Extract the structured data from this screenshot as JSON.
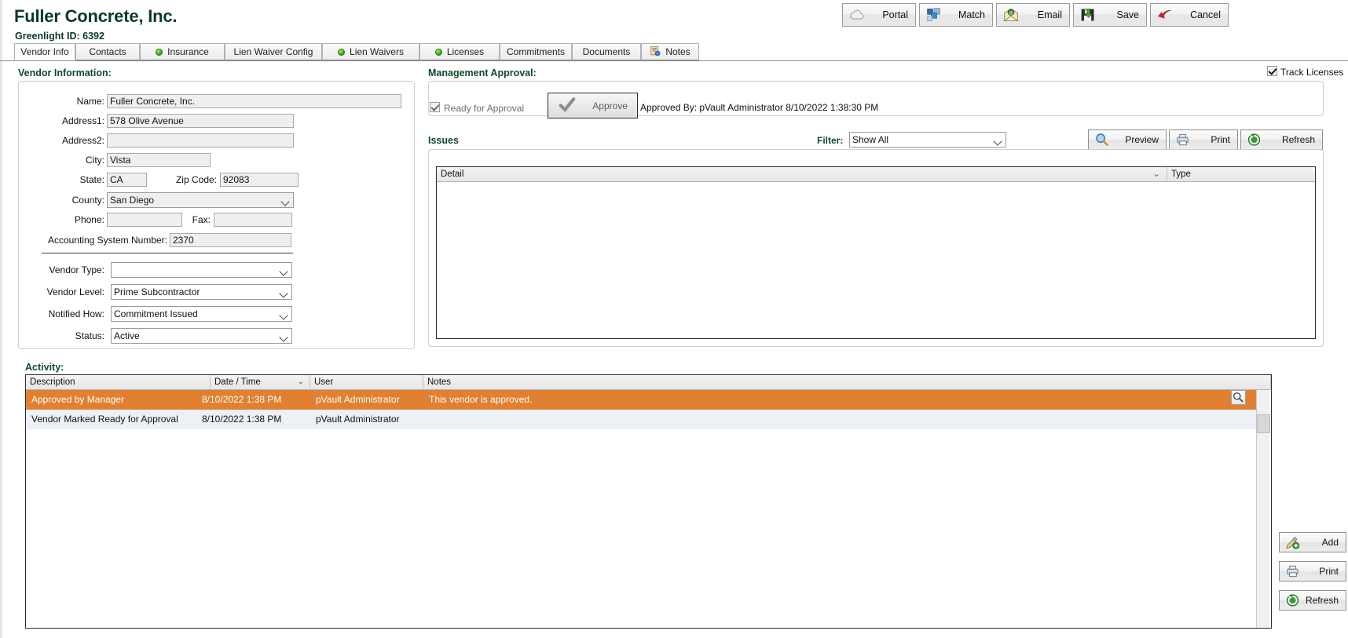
{
  "header": {
    "title": "Fuller Concrete, Inc.",
    "subtitle": "Greenlight ID: 6392",
    "toolbar": [
      {
        "label": "Portal",
        "icon": "cloud-icon"
      },
      {
        "label": "Match",
        "icon": "match-squares-icon"
      },
      {
        "label": "Email",
        "icon": "envelope-icon"
      },
      {
        "label": "Save",
        "icon": "floppy-disk-icon"
      },
      {
        "label": "Cancel",
        "icon": "red-arrow-icon"
      }
    ]
  },
  "tabs": [
    {
      "label": "Vendor Info",
      "active": true,
      "status_dot": false,
      "icon": ""
    },
    {
      "label": "Contacts",
      "active": false,
      "status_dot": false,
      "icon": ""
    },
    {
      "label": "Insurance",
      "active": false,
      "status_dot": true,
      "icon": ""
    },
    {
      "label": "Lien Waiver Config",
      "active": false,
      "status_dot": false,
      "icon": ""
    },
    {
      "label": "Lien Waivers",
      "active": false,
      "status_dot": true,
      "icon": ""
    },
    {
      "label": "Licenses",
      "active": false,
      "status_dot": true,
      "icon": ""
    },
    {
      "label": "Commitments",
      "active": false,
      "status_dot": false,
      "icon": ""
    },
    {
      "label": "Documents",
      "active": false,
      "status_dot": false,
      "icon": ""
    },
    {
      "label": "Notes",
      "active": false,
      "status_dot": false,
      "icon": "notes-document-icon"
    }
  ],
  "track_licenses": {
    "label": "Track Licenses",
    "checked": true
  },
  "vendor_information": {
    "section_label": "Vendor Information:",
    "fields": {
      "name_label": "Name:",
      "name_value": "Fuller Concrete, Inc.",
      "address1_label": "Address1:",
      "address1_value": "578 Olive Avenue",
      "address2_label": "Address2:",
      "address2_value": "",
      "city_label": "City:",
      "city_value": "Vista",
      "state_label": "State:",
      "state_value": "CA",
      "zip_label": "Zip Code:",
      "zip_value": "92083",
      "county_label": "County:",
      "county_value": "San Diego",
      "phone_label": "Phone:",
      "phone_value": "",
      "fax_label": "Fax:",
      "fax_value": "",
      "accounting_label": "Accounting System Number:",
      "accounting_value": "2370",
      "vendor_type_label": "Vendor Type:",
      "vendor_type_value": "",
      "vendor_level_label": "Vendor Level:",
      "vendor_level_value": "Prime Subcontractor",
      "notified_how_label": "Notified How:",
      "notified_how_value": "Commitment Issued",
      "status_label": "Status:",
      "status_value": "Active"
    }
  },
  "management_approval": {
    "section_label": "Management Approval:",
    "ready_for_approval_label": "Ready for Approval",
    "ready_for_approval_checked": true,
    "approve_button_label": "Approve",
    "approved_by_text": "Approved By: pVault Administrator 8/10/2022 1:38:30 PM"
  },
  "issues": {
    "section_label": "Issues",
    "filter_label": "Filter:",
    "filter_value": "Show All",
    "buttons": [
      {
        "label": "Preview",
        "icon": "magnifier-icon"
      },
      {
        "label": "Print",
        "icon": "printer-icon"
      },
      {
        "label": "Refresh",
        "icon": "refresh-icon"
      }
    ],
    "columns": [
      "Detail",
      "Type"
    ],
    "rows": []
  },
  "activity": {
    "section_label": "Activity:",
    "columns": [
      "Description",
      "Date / Time",
      "User",
      "Notes"
    ],
    "sort_column": "Date / Time",
    "rows": [
      {
        "description": "Approved by Manager",
        "datetime": "8/10/2022 1:38 PM",
        "user": "pVault Administrator",
        "notes": "This vendor is approved.",
        "selected": true
      },
      {
        "description": "Vendor Marked Ready for Approval",
        "datetime": "8/10/2022 1:38 PM",
        "user": "pVault Administrator",
        "notes": "",
        "selected": false
      }
    ],
    "buttons": [
      {
        "label": "Add",
        "icon": "add-pencil-icon"
      },
      {
        "label": "Print",
        "icon": "printer-icon"
      },
      {
        "label": "Refresh",
        "icon": "refresh-icon"
      }
    ],
    "row_inspect_icon": "magnifier-icon"
  },
  "colors": {
    "heading_green": "#10492b",
    "selected_row_orange": "#e08030",
    "alt_row_blue": "#eef0f8",
    "status_dot_green": "#35a513"
  }
}
